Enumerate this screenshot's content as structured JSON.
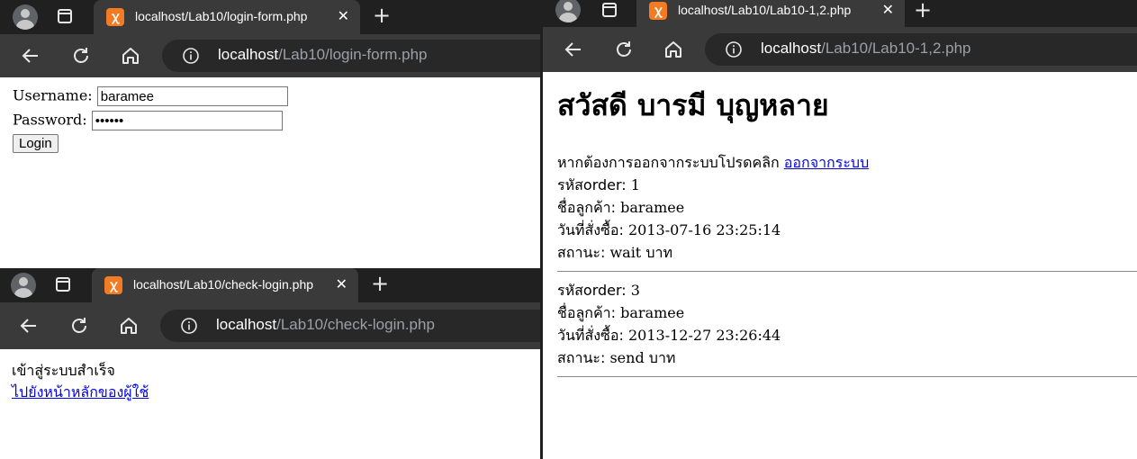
{
  "windows": [
    {
      "tab_title": "localhost/Lab10/login-form.php",
      "url_host": "localhost",
      "url_path": "/Lab10/login-form.php"
    },
    {
      "tab_title": "localhost/Lab10/check-login.php",
      "url_host": "localhost",
      "url_path": "/Lab10/check-login.php"
    },
    {
      "tab_title": "localhost/Lab10/Lab10-1,2.php",
      "url_host": "localhost",
      "url_path": "/Lab10/Lab10-1,2.php"
    }
  ],
  "login_form": {
    "username_label": "Username:",
    "username_value": "baramee",
    "password_label": "Password:",
    "password_value": "••••••",
    "login_button": "Login"
  },
  "check_login": {
    "message": "เข้าสู่ระบบสำเร็จ",
    "link": "ไปยังหน้าหลักของผู้ใช้"
  },
  "user_page": {
    "greeting": "สวัสดี บารมี บุญหลาย",
    "logout_prompt": "หากต้องการออกจากระบบโปรดคลิก",
    "logout_link": "ออกจากระบบ",
    "labels": {
      "order_id": "รหัสorder:",
      "customer": "ชื่อลูกค้า:",
      "date": "วันที่สั่งซื้อ:",
      "status": "สถานะ:",
      "currency": "บาท"
    },
    "orders": [
      {
        "order_id": "1",
        "customer": "baramee",
        "date": "2013-07-16 23:25:14",
        "status": "wait"
      },
      {
        "order_id": "3",
        "customer": "baramee",
        "date": "2013-12-27 23:26:44",
        "status": "send"
      }
    ]
  },
  "colors": {
    "tabbar_bg": "#202020",
    "toolbar_bg": "#3a3a3a",
    "xampp_orange": "#f37b24",
    "link_blue": "#0000ee"
  },
  "icons": [
    "avatar-icon",
    "tab-actions-icon",
    "xampp-favicon",
    "close-icon",
    "new-tab-icon",
    "back-icon",
    "reload-icon",
    "home-icon",
    "info-icon"
  ]
}
